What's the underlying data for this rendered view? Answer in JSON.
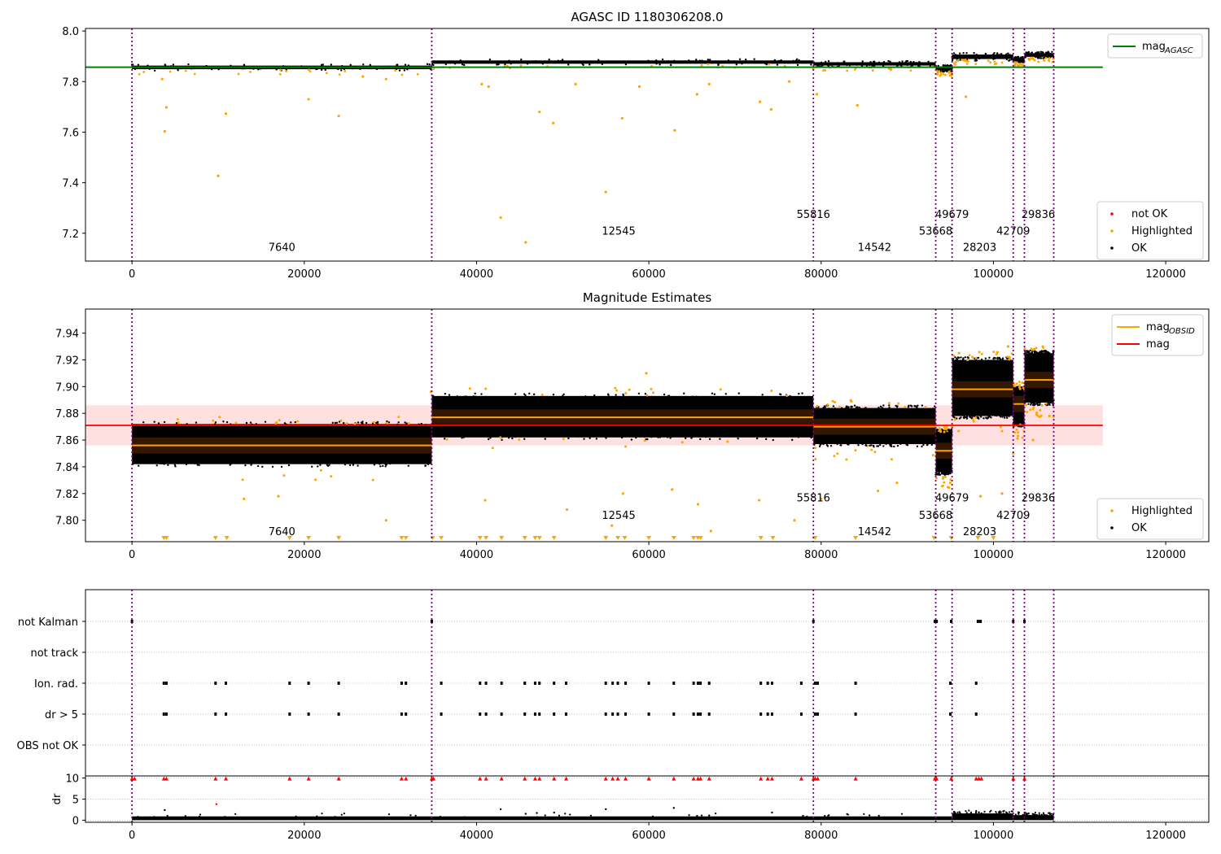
{
  "chart_data": [
    {
      "type": "scatter",
      "title": "AGASC ID 1180306208.0",
      "xlim": [
        -5400,
        125000
      ],
      "ylim": [
        7.09,
        8.01
      ],
      "xticks": [
        0,
        20000,
        40000,
        60000,
        80000,
        100000,
        120000
      ],
      "yticks": [
        7.2,
        7.4,
        7.6,
        7.8,
        8.0
      ],
      "ytick_labels": [
        "7.2",
        "7.4",
        "7.6",
        "7.8",
        "8.0"
      ],
      "grid": false,
      "agasc_mag": 7.857,
      "agasc_mag_xrange": [
        -5400,
        112700
      ],
      "obs_boundaries": [
        0,
        34800,
        79100,
        93300,
        95200,
        102300,
        103600,
        107000
      ],
      "obs_labels": [
        {
          "text": "7640",
          "x": 17400,
          "y": 7.13
        },
        {
          "text": "12545",
          "x": 56500,
          "y": 7.195
        },
        {
          "text": "55816",
          "x": 79100,
          "y": 7.26
        },
        {
          "text": "14542",
          "x": 86200,
          "y": 7.13
        },
        {
          "text": "53668",
          "x": 93300,
          "y": 7.195
        },
        {
          "text": "49679",
          "x": 95200,
          "y": 7.26
        },
        {
          "text": "28203",
          "x": 98400,
          "y": 7.13
        },
        {
          "text": "42709",
          "x": 102300,
          "y": 7.195
        },
        {
          "text": "29836",
          "x": 105200,
          "y": 7.26
        }
      ],
      "segments": [
        {
          "x": [
            0,
            34800
          ],
          "center": 7.856,
          "spread": 0.013
        },
        {
          "x": [
            34800,
            79100
          ],
          "center": 7.877,
          "spread": 0.012
        },
        {
          "x": [
            79100,
            93300
          ],
          "center": 7.87,
          "spread": 0.012
        },
        {
          "x": [
            93300,
            95200
          ],
          "center": 7.852,
          "spread": 0.013
        },
        {
          "x": [
            95200,
            102300
          ],
          "center": 7.898,
          "spread": 0.016
        },
        {
          "x": [
            102300,
            103600
          ],
          "center": 7.887,
          "spread": 0.011
        },
        {
          "x": [
            103600,
            107000
          ],
          "center": 7.905,
          "spread": 0.013
        }
      ],
      "highlighted_points": [
        [
          3800,
          7.603
        ],
        [
          4000,
          7.698
        ],
        [
          10000,
          7.427
        ],
        [
          10900,
          7.673
        ],
        [
          24000,
          7.664
        ],
        [
          20500,
          7.73
        ],
        [
          42800,
          7.262
        ],
        [
          45700,
          7.164
        ],
        [
          47300,
          7.68
        ],
        [
          48900,
          7.636
        ],
        [
          55000,
          7.363
        ],
        [
          56900,
          7.655
        ],
        [
          63000,
          7.607
        ],
        [
          65600,
          7.75
        ],
        [
          72900,
          7.72
        ],
        [
          74200,
          7.69
        ],
        [
          84200,
          7.706
        ],
        [
          79500,
          7.75
        ],
        [
          96800,
          7.74
        ],
        [
          3500,
          7.81
        ],
        [
          26800,
          7.82
        ],
        [
          29500,
          7.81
        ],
        [
          40600,
          7.79
        ],
        [
          41400,
          7.78
        ],
        [
          51500,
          7.79
        ],
        [
          58900,
          7.78
        ],
        [
          67000,
          7.79
        ],
        [
          76300,
          7.8
        ]
      ],
      "legends": [
        {
          "placement": "top-right",
          "entries": [
            {
              "label": "mag",
              "subscript": "AGASC",
              "color": "#008000",
              "kind": "line"
            }
          ]
        },
        {
          "placement": "lower-right",
          "entries": [
            {
              "label": "not OK",
              "color": "#ff0000",
              "kind": "marker"
            },
            {
              "label": "Highlighted",
              "color": "#ffa500",
              "kind": "marker"
            },
            {
              "label": "OK",
              "color": "#000000",
              "kind": "marker"
            }
          ]
        }
      ]
    },
    {
      "type": "scatter",
      "title": "Magnitude Estimates",
      "xlim": [
        -5400,
        125000
      ],
      "ylim": [
        7.784,
        7.958
      ],
      "xticks": [
        0,
        20000,
        40000,
        60000,
        80000,
        100000,
        120000
      ],
      "yticks": [
        7.8,
        7.82,
        7.84,
        7.86,
        7.88,
        7.9,
        7.92,
        7.94
      ],
      "ytick_labels": [
        "7.80",
        "7.82",
        "7.84",
        "7.86",
        "7.88",
        "7.90",
        "7.92",
        "7.94"
      ],
      "grid": false,
      "mag": 7.871,
      "mag_band": [
        7.856,
        7.886
      ],
      "mag_xrange": [
        -5400,
        112700
      ],
      "obs_boundaries": [
        0,
        34800,
        79100,
        93300,
        95200,
        102300,
        103600,
        107000
      ],
      "obs_labels": [
        {
          "text": "7640",
          "x": 17400,
          "y": 7.789
        },
        {
          "text": "12545",
          "x": 56500,
          "y": 7.801
        },
        {
          "text": "55816",
          "x": 79100,
          "y": 7.814
        },
        {
          "text": "14542",
          "x": 86200,
          "y": 7.789
        },
        {
          "text": "53668",
          "x": 93300,
          "y": 7.801
        },
        {
          "text": "49679",
          "x": 95200,
          "y": 7.814
        },
        {
          "text": "28203",
          "x": 98400,
          "y": 7.789
        },
        {
          "text": "42709",
          "x": 102300,
          "y": 7.801
        },
        {
          "text": "29836",
          "x": 105200,
          "y": 7.814
        }
      ],
      "segments": [
        {
          "x": [
            0,
            34800
          ],
          "mag_obsid": 7.856,
          "range": [
            7.842,
            7.872
          ]
        },
        {
          "x": [
            34800,
            79100
          ],
          "mag_obsid": 7.877,
          "range": [
            7.862,
            7.893
          ]
        },
        {
          "x": [
            79100,
            93300
          ],
          "mag_obsid": 7.87,
          "range": [
            7.857,
            7.884
          ]
        },
        {
          "x": [
            93300,
            95200
          ],
          "mag_obsid": 7.852,
          "range": [
            7.836,
            7.866
          ]
        },
        {
          "x": [
            95200,
            102300
          ],
          "mag_obsid": 7.898,
          "range": [
            7.878,
            7.92
          ]
        },
        {
          "x": [
            102300,
            103600
          ],
          "mag_obsid": 7.887,
          "range": [
            7.872,
            7.898
          ]
        },
        {
          "x": [
            103600,
            107000
          ],
          "mag_obsid": 7.905,
          "range": [
            7.888,
            7.925
          ]
        }
      ],
      "highlighted_points": [
        [
          13000,
          7.816
        ],
        [
          17000,
          7.818
        ],
        [
          29500,
          7.8
        ],
        [
          34700,
          7.896
        ],
        [
          41000,
          7.815
        ],
        [
          50500,
          7.808
        ],
        [
          55700,
          7.796
        ],
        [
          57000,
          7.82
        ],
        [
          59700,
          7.91
        ],
        [
          62700,
          7.823
        ],
        [
          65700,
          7.812
        ],
        [
          67200,
          7.792
        ],
        [
          72800,
          7.815
        ],
        [
          76900,
          7.8
        ],
        [
          80000,
          7.816
        ],
        [
          86600,
          7.822
        ],
        [
          88800,
          7.828
        ],
        [
          97000,
          7.92
        ],
        [
          98500,
          7.818
        ],
        [
          101000,
          7.82
        ],
        [
          102300,
          7.85
        ],
        [
          104600,
          7.86
        ],
        [
          106500,
          7.878
        ],
        [
          101700,
          7.93
        ],
        [
          96000,
          7.925
        ]
      ],
      "clipped_markers_x": [
        3700,
        4000,
        9700,
        11000,
        18300,
        20500,
        24000,
        31300,
        31800,
        34900,
        35900,
        40400,
        41100,
        42900,
        45600,
        46800,
        47300,
        49000,
        55000,
        56400,
        57200,
        60000,
        62900,
        65200,
        65700,
        66000,
        73000,
        74400,
        79300,
        84000,
        93100,
        95100,
        98200,
        100000
      ],
      "legends": [
        {
          "placement": "top-right",
          "entries": [
            {
              "label": "mag",
              "subscript": "OBSID",
              "color": "#ffa500",
              "kind": "line"
            },
            {
              "label": "mag",
              "color": "#ff0000",
              "kind": "line"
            }
          ]
        },
        {
          "placement": "lower-right",
          "entries": [
            {
              "label": "Highlighted",
              "color": "#ffa500",
              "kind": "marker"
            },
            {
              "label": "OK",
              "color": "#000000",
              "kind": "marker"
            }
          ]
        }
      ]
    },
    {
      "type": "scatter",
      "xlim": [
        -5400,
        125000
      ],
      "categories": [
        "not Kalman",
        "not track",
        "Ion. rad.",
        "dr > 5",
        "OBS not OK"
      ],
      "grid": true,
      "obs_boundaries": [
        0,
        34800,
        79100,
        93300,
        95200,
        102300,
        103600,
        107000
      ],
      "flags": {
        "not Kalman": [
          0,
          34800,
          79100,
          93200,
          93400,
          95100,
          98200,
          98500,
          102300,
          103600
        ],
        "not track": [],
        "Ion. rad.": [
          3700,
          4000,
          9700,
          10900,
          18300,
          20500,
          24000,
          31300,
          31800,
          35900,
          40400,
          41100,
          42900,
          45600,
          46800,
          47300,
          49000,
          50400,
          55000,
          55800,
          56400,
          57300,
          60000,
          62900,
          65200,
          65700,
          66000,
          67000,
          73000,
          73800,
          74300,
          77700,
          79300,
          79600,
          84000,
          95000,
          98000
        ],
        "dr > 5": [
          3700,
          4000,
          9700,
          10900,
          18300,
          20500,
          24000,
          31300,
          31800,
          35900,
          40400,
          41100,
          42900,
          45600,
          46800,
          47300,
          49000,
          50400,
          55000,
          55800,
          56400,
          57300,
          60000,
          62900,
          65200,
          65700,
          66000,
          67000,
          73000,
          73800,
          74300,
          77700,
          79300,
          79600,
          84000,
          95000,
          98000
        ],
        "OBS not OK": []
      }
    },
    {
      "type": "scatter",
      "xlim": [
        -5400,
        125000
      ],
      "xticks": [
        0,
        20000,
        40000,
        60000,
        80000,
        100000,
        120000
      ],
      "ylim": [
        -0.5,
        10.5
      ],
      "yticks": [
        0,
        5,
        10
      ],
      "ytick_labels": [
        "0",
        "5",
        "10"
      ],
      "ylabel": "dr",
      "grid": true,
      "obs_boundaries": [
        0,
        34800,
        79100,
        93300,
        95200,
        102300,
        103600,
        107000
      ],
      "baseline_segments": [
        {
          "x": [
            0,
            95200
          ],
          "dr": 0.3
        },
        {
          "x": [
            95200,
            102300
          ],
          "dr": 1.0
        },
        {
          "x": [
            102300,
            107000
          ],
          "dr": 0.6
        }
      ],
      "clipped_points_x": [
        0,
        300,
        3700,
        4000,
        9700,
        10900,
        18300,
        20500,
        24000,
        31300,
        31800,
        34800,
        35000,
        40400,
        41100,
        42900,
        45600,
        46800,
        47300,
        49000,
        50400,
        55000,
        55800,
        56400,
        57300,
        60000,
        62900,
        65200,
        65700,
        66000,
        67000,
        73000,
        73800,
        74300,
        77700,
        79100,
        79300,
        79600,
        84000,
        93200,
        93400,
        95100,
        98000,
        98300,
        98600,
        102300,
        103600
      ],
      "scattered_points": [
        [
          3800,
          2.4
        ],
        [
          9800,
          3.8
        ],
        [
          42800,
          2.6
        ],
        [
          45700,
          1.5
        ],
        [
          47000,
          1.7
        ],
        [
          49000,
          1.8
        ],
        [
          55000,
          2.6
        ],
        [
          62900,
          2.9
        ],
        [
          65600,
          1.0
        ],
        [
          67000,
          1.1
        ],
        [
          74300,
          1.8
        ],
        [
          77900,
          1.0
        ]
      ]
    }
  ]
}
